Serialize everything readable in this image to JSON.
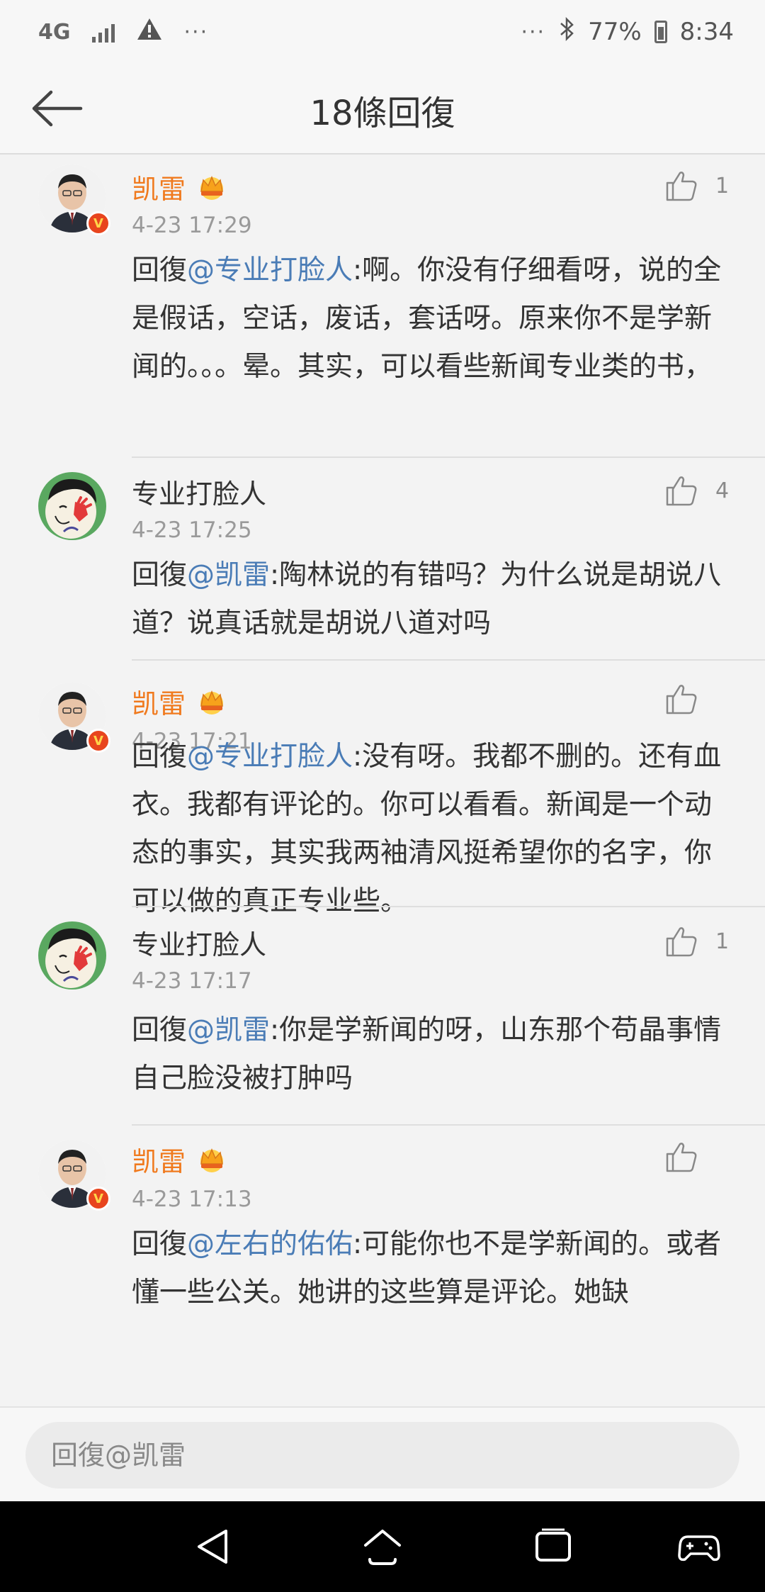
{
  "status_bar": {
    "network": "4G",
    "dots_left": "···",
    "dots_right": "···",
    "battery_percent": "77%",
    "time": "8:34"
  },
  "header": {
    "title": "18條回復",
    "back_icon": "arrow-left-icon"
  },
  "comments": [
    {
      "username": "凯雷",
      "vip": true,
      "verified": true,
      "timestamp": "4-23 17:29",
      "likes": "1",
      "prefix": "回復",
      "mention": "@专业打脸人",
      "text": ":啊。你没有仔细看呀，说的全是假话，空话，废话，套话呀。原来你不是学新闻的。。。晕。其实，可以看些新闻专业类的书，"
    },
    {
      "username": "专业打脸人",
      "vip": false,
      "verified": false,
      "timestamp": "4-23 17:25",
      "likes": "4",
      "prefix": "回復",
      "mention": "@凯雷",
      "text": ":陶林说的有错吗？为什么说是胡说八道？说真话就是胡说八道对吗"
    },
    {
      "username": "凯雷",
      "vip": true,
      "verified": true,
      "timestamp": "4-23 17:21",
      "likes": "",
      "prefix": "回復",
      "mention": "@专业打脸人",
      "text": ":没有呀。我都不删的。还有血衣。我都有评论的。你可以看看。新闻是一个动态的事实，其实我两袖清风挺希望你的名字，你可以做的真正专业些。"
    },
    {
      "username": "专业打脸人",
      "vip": false,
      "verified": false,
      "timestamp": "4-23 17:17",
      "likes": "1",
      "prefix": "回復",
      "mention": "@凯雷",
      "text": ":你是学新闻的呀，山东那个苟晶事情自己脸没被打肿吗"
    },
    {
      "username": "凯雷",
      "vip": true,
      "verified": true,
      "timestamp": "4-23 17:13",
      "likes": "",
      "prefix": "回復",
      "mention": "@左右的佑佑",
      "text": ":可能你也不是学新闻的。或者懂一些公关。她讲的这些算是评论。她缺"
    }
  ],
  "reply_bar": {
    "placeholder": "回復@凯雷"
  },
  "colors": {
    "vip_name": "#f07a1e",
    "mention": "#4a7cb6",
    "timestamp": "#9a9a9a",
    "background": "#f3f3f3",
    "navbar": "#000000"
  }
}
